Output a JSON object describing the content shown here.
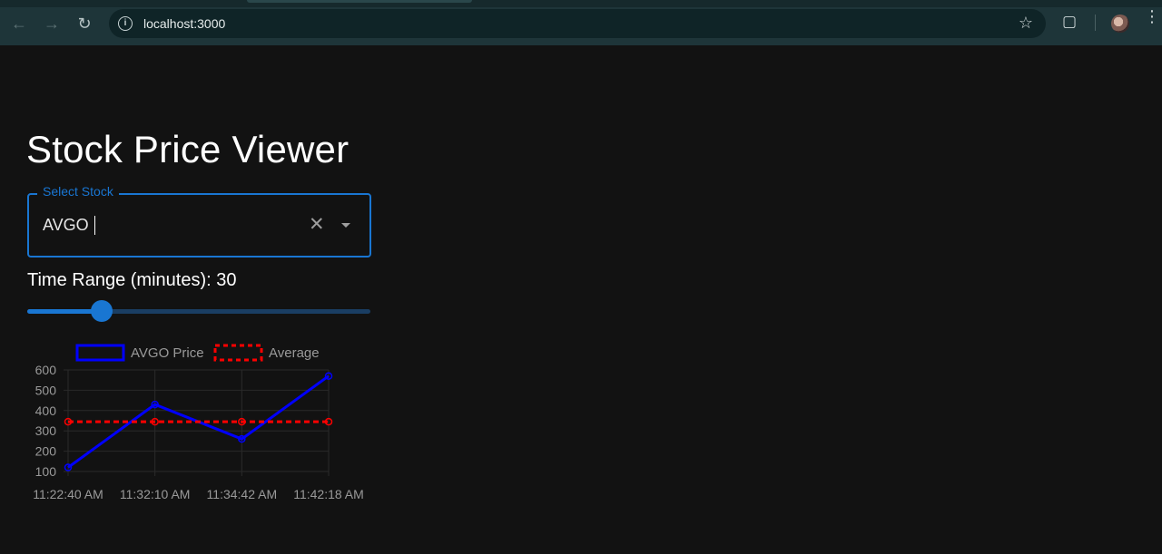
{
  "browser": {
    "url": "localhost:3000"
  },
  "page": {
    "title": "Stock Price Viewer",
    "select_label": "Select Stock",
    "select_value": "AVGO",
    "range_label_prefix": "Time Range (minutes): ",
    "range_value": 30,
    "range_label": "Time Range (minutes): 30",
    "slider_fraction": 0.217
  },
  "chart_data": {
    "type": "line",
    "categories": [
      "11:22:40 AM",
      "11:32:10 AM",
      "11:34:42 AM",
      "11:42:18 AM"
    ],
    "series": [
      {
        "name": "AVGO Price",
        "values": [
          120,
          430,
          260,
          570
        ],
        "color": "#0000ff",
        "style": "solid"
      },
      {
        "name": "Average",
        "values": [
          345,
          345,
          345,
          345
        ],
        "color": "#ff0000",
        "style": "dashed"
      }
    ],
    "yticks": [
      100,
      200,
      300,
      400,
      500,
      600
    ],
    "ylim": [
      100,
      600
    ],
    "legend": "top",
    "grid": true
  }
}
